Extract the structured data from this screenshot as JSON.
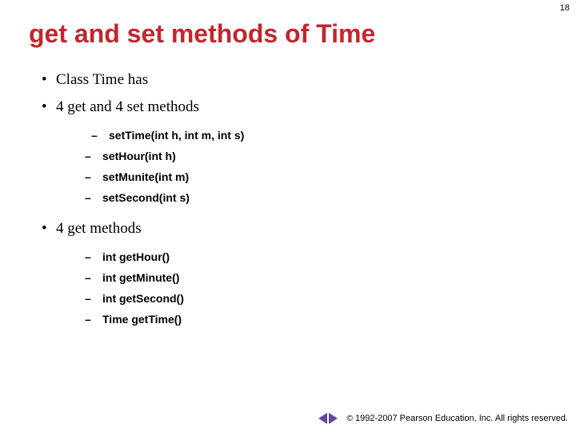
{
  "pageNumber": "18",
  "title": "get and set methods of Time",
  "bullets": {
    "b1": "Class Time has",
    "b2": "4 get and 4 set methods",
    "b3": "4 get methods"
  },
  "setMethods": {
    "m1": " setTime(int h, int m, int s)",
    "m2": "setHour(int h)",
    "m3": "setMunite(int m)",
    "m4": "setSecond(int s)"
  },
  "getMethods": {
    "m1": "int getHour()",
    "m2": "int getMinute()",
    "m3": "int getSecond()",
    "m4": "Time getTime()"
  },
  "footer": {
    "copySymbol": "©",
    "text": "1992-2007 Pearson Education, Inc. All rights reserved."
  }
}
